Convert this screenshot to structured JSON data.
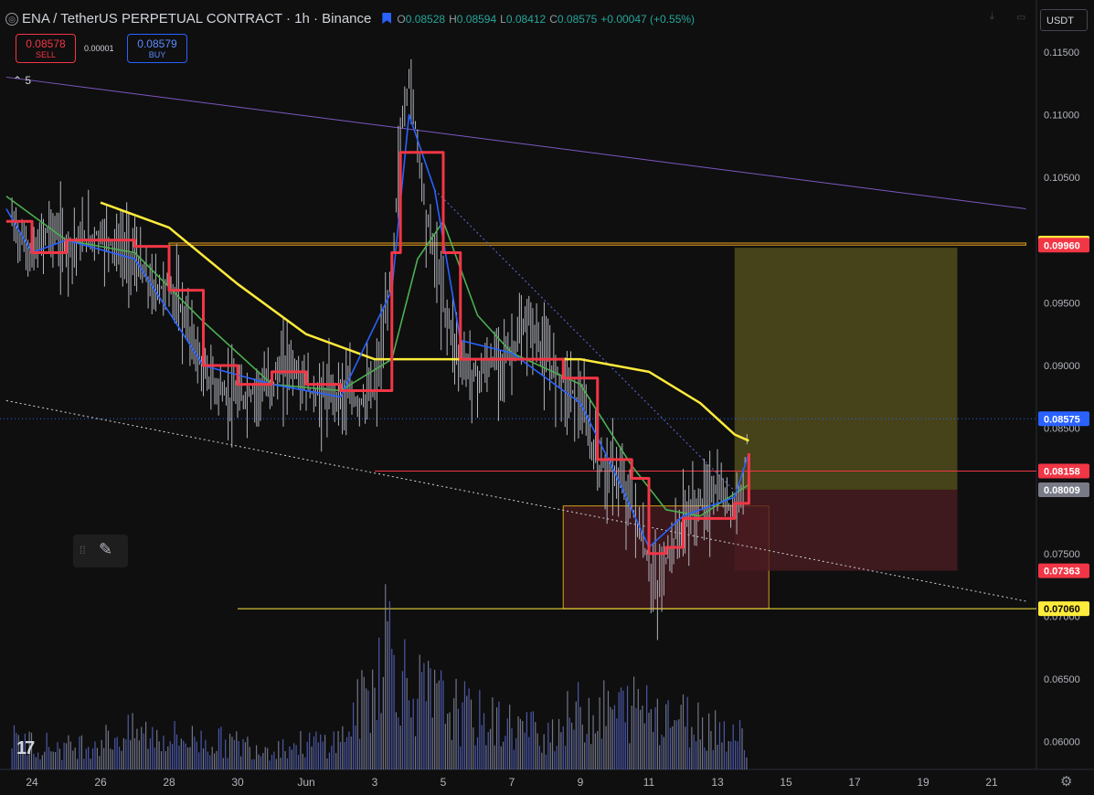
{
  "header": {
    "title": "ENA / TetherUS PERPETUAL CONTRACT · 1h · Binance",
    "ohlc": {
      "o_label": "O",
      "o": "0.08528",
      "h_label": "H",
      "h": "0.08594",
      "l_label": "L",
      "l": "0.08412",
      "c_label": "C",
      "c": "0.08575",
      "change": "+0.00047 (+0.55%)"
    }
  },
  "trade": {
    "sell_price": "0.08578",
    "sell_label": "SELL",
    "buy_price": "0.08579",
    "buy_label": "BUY",
    "spread": "0.00001"
  },
  "indicators_collapsed": "5",
  "currency": "USDT",
  "icons": {
    "symbol": "symbol-icon",
    "flag": "flag-icon",
    "drawing": "brush-icon",
    "settings": "gear-icon",
    "logo": "tradingview-logo"
  },
  "colors": {
    "background": "#0f0f0f",
    "bar": "#b2b5be",
    "ema_red": "#f23645",
    "ma_blue": "#2962ff",
    "ma_green": "#4caf50",
    "ma_yellow": "#ffeb3b",
    "trend_purple": "#7e57c2",
    "zone_fill": "#4a1b20",
    "zone_border": "#d4a017",
    "target_fill": "#6b6420",
    "stop_fill": "#4a1b20",
    "volume": "#3d4aa0"
  },
  "chart_data": {
    "type": "line",
    "symbol": "ENA/USDT",
    "timeframe": "1h",
    "ylim": [
      0.0585,
      0.1175
    ],
    "y_ticks": [
      "0.11500",
      "0.11000",
      "0.10500",
      "0.10000",
      "0.09500",
      "0.09000",
      "0.08500",
      "0.08000",
      "0.07500",
      "0.07000",
      "0.06500",
      "0.06000"
    ],
    "x_ticks": [
      "24",
      "26",
      "28",
      "30",
      "Jun",
      "3",
      "5",
      "7",
      "9",
      "11",
      "13",
      "15",
      "17",
      "19",
      "21"
    ],
    "grid": false,
    "price_path": [
      {
        "t": "May 23 10:00",
        "p": 0.1015
      },
      {
        "t": "May 24 00:00",
        "p": 0.0985
      },
      {
        "t": "May 24 12:00",
        "p": 0.101
      },
      {
        "t": "May 25 00:00",
        "p": 0.0995
      },
      {
        "t": "May 26 00:00",
        "p": 0.1005
      },
      {
        "t": "May 27 00:00",
        "p": 0.0985
      },
      {
        "t": "May 27 12:00",
        "p": 0.096
      },
      {
        "t": "May 28 00:00",
        "p": 0.0965
      },
      {
        "t": "May 28 12:00",
        "p": 0.0935
      },
      {
        "t": "May 29 00:00",
        "p": 0.0895
      },
      {
        "t": "May 29 12:00",
        "p": 0.088
      },
      {
        "t": "May 30 00:00",
        "p": 0.087
      },
      {
        "t": "May 30 12:00",
        "p": 0.088
      },
      {
        "t": "May 31 00:00",
        "p": 0.0885
      },
      {
        "t": "May 31 12:00",
        "p": 0.0905
      },
      {
        "t": "Jun 1 00:00",
        "p": 0.088
      },
      {
        "t": "Jun 1 12:00",
        "p": 0.0875
      },
      {
        "t": "Jun 2 00:00",
        "p": 0.088
      },
      {
        "t": "Jun 2 12:00",
        "p": 0.087
      },
      {
        "t": "Jun 3 00:00",
        "p": 0.088
      },
      {
        "t": "Jun 3 06:00",
        "p": 0.092
      },
      {
        "t": "Jun 3 12:00",
        "p": 0.0975
      },
      {
        "t": "Jun 3 18:00",
        "p": 0.108
      },
      {
        "t": "Jun 4 00:00",
        "p": 0.113
      },
      {
        "t": "Jun 4 06:00",
        "p": 0.108
      },
      {
        "t": "Jun 4 12:00",
        "p": 0.102
      },
      {
        "t": "Jun 4 18:00",
        "p": 0.099
      },
      {
        "t": "Jun 5 00:00",
        "p": 0.095
      },
      {
        "t": "Jun 5 12:00",
        "p": 0.0905
      },
      {
        "t": "Jun 6 00:00",
        "p": 0.089
      },
      {
        "t": "Jun 6 12:00",
        "p": 0.0905
      },
      {
        "t": "Jun 7 00:00",
        "p": 0.091
      },
      {
        "t": "Jun 7 12:00",
        "p": 0.0935
      },
      {
        "t": "Jun 8 00:00",
        "p": 0.0905
      },
      {
        "t": "Jun 8 12:00",
        "p": 0.089
      },
      {
        "t": "Jun 9 00:00",
        "p": 0.087
      },
      {
        "t": "Jun 9 12:00",
        "p": 0.082
      },
      {
        "t": "Jun 10 00:00",
        "p": 0.0815
      },
      {
        "t": "Jun 10 12:00",
        "p": 0.079
      },
      {
        "t": "Jun 11 00:00",
        "p": 0.074
      },
      {
        "t": "Jun 11 06:00",
        "p": 0.072
      },
      {
        "t": "Jun 11 12:00",
        "p": 0.0745
      },
      {
        "t": "Jun 12 00:00",
        "p": 0.0775
      },
      {
        "t": "Jun 12 12:00",
        "p": 0.079
      },
      {
        "t": "Jun 13 00:00",
        "p": 0.08
      },
      {
        "t": "Jun 13 12:00",
        "p": 0.0785
      },
      {
        "t": "Jun 13 18:00",
        "p": 0.081
      },
      {
        "t": "Jun 13 22:00",
        "p": 0.0857
      }
    ],
    "last_price": 0.08575,
    "levels": [
      {
        "label": "0.09977",
        "value": 0.09977,
        "color": "#ffeb3b",
        "text_color": "#000000"
      },
      {
        "label": "0.09960",
        "value": 0.0996,
        "color": "#f23645",
        "text_color": "#ffffff"
      },
      {
        "label": "0.08575",
        "value": 0.08575,
        "color": "#2962ff",
        "text_color": "#ffffff"
      },
      {
        "label": "0.08158",
        "value": 0.08158,
        "color": "#f23645",
        "text_color": "#ffffff"
      },
      {
        "label": "0.08009",
        "value": 0.08009,
        "color": "#787b86",
        "text_color": "#ffffff"
      },
      {
        "label": "0.07363",
        "value": 0.07363,
        "color": "#f23645",
        "text_color": "#ffffff"
      },
      {
        "label": "0.07060",
        "value": 0.0706,
        "color": "#ffeb3b",
        "text_color": "#000000"
      }
    ],
    "zones": [
      {
        "name": "supply-zone",
        "t_start": "May 28 00:00",
        "t_end": "Jun 22 00:00",
        "top": 0.09977,
        "bottom": 0.0996
      },
      {
        "name": "demand-zone",
        "t_start": "Jun 8 12:00",
        "t_end": "Jun 14 12:00",
        "top": 0.0788,
        "bottom": 0.0706
      }
    ],
    "position": {
      "t_start": "Jun 13 12:00",
      "t_end": "Jun 20 00:00",
      "target": 0.0994,
      "entry": 0.08009,
      "stop": 0.07363
    },
    "trendlines": [
      {
        "name": "resistance-trendline",
        "from": {
          "t": "May 23 06:00",
          "p": 0.113
        },
        "to": {
          "t": "Jun 22 00:00",
          "p": 0.1025
        }
      },
      {
        "name": "support-trendline",
        "from": {
          "t": "May 23 06:00",
          "p": 0.0872
        },
        "to": {
          "t": "Jun 22 00:00",
          "p": 0.0712
        }
      }
    ],
    "horizontal_lines": [
      {
        "name": "low-line",
        "value": 0.0706,
        "t_start": "May 30 00:00"
      },
      {
        "name": "mid-line",
        "value": 0.08158,
        "t_start": "Jun 3 00:00"
      }
    ],
    "moving_averages": [
      {
        "name": "ma-yellow",
        "color": "#ffeb3b",
        "points": [
          {
            "t": "May 26 00:00",
            "p": 0.103
          },
          {
            "t": "May 28 00:00",
            "p": 0.101
          },
          {
            "t": "May 30 00:00",
            "p": 0.0965
          },
          {
            "t": "Jun 1 00:00",
            "p": 0.0925
          },
          {
            "t": "Jun 3 00:00",
            "p": 0.0905
          },
          {
            "t": "Jun 5 00:00",
            "p": 0.0905
          },
          {
            "t": "Jun 7 00:00",
            "p": 0.0905
          },
          {
            "t": "Jun 9 00:00",
            "p": 0.0905
          },
          {
            "t": "Jun 11 00:00",
            "p": 0.0895
          },
          {
            "t": "Jun 12 12:00",
            "p": 0.087
          },
          {
            "t": "Jun 13 12:00",
            "p": 0.0845
          },
          {
            "t": "Jun 13 22:00",
            "p": 0.084
          }
        ]
      },
      {
        "name": "ma-green",
        "color": "#4caf50",
        "points": [
          {
            "t": "May 23 06:00",
            "p": 0.1035
          },
          {
            "t": "May 25 00:00",
            "p": 0.1
          },
          {
            "t": "May 27 00:00",
            "p": 0.099
          },
          {
            "t": "May 29 00:00",
            "p": 0.0935
          },
          {
            "t": "May 31 00:00",
            "p": 0.0885
          },
          {
            "t": "Jun 2 00:00",
            "p": 0.088
          },
          {
            "t": "Jun 3 12:00",
            "p": 0.0905
          },
          {
            "t": "Jun 4 06:00",
            "p": 0.0985
          },
          {
            "t": "Jun 5 00:00",
            "p": 0.1015
          },
          {
            "t": "Jun 6 00:00",
            "p": 0.094
          },
          {
            "t": "Jun 7 00:00",
            "p": 0.091
          },
          {
            "t": "Jun 9 00:00",
            "p": 0.0885
          },
          {
            "t": "Jun 10 12:00",
            "p": 0.082
          },
          {
            "t": "Jun 11 12:00",
            "p": 0.0785
          },
          {
            "t": "Jun 12 12:00",
            "p": 0.078
          },
          {
            "t": "Jun 13 22:00",
            "p": 0.0805
          }
        ]
      },
      {
        "name": "ma-blue",
        "color": "#2962ff",
        "points": [
          {
            "t": "May 23 06:00",
            "p": 0.1025
          },
          {
            "t": "May 24 00:00",
            "p": 0.099
          },
          {
            "t": "May 25 00:00",
            "p": 0.1
          },
          {
            "t": "May 27 00:00",
            "p": 0.0985
          },
          {
            "t": "May 29 00:00",
            "p": 0.09
          },
          {
            "t": "May 31 00:00",
            "p": 0.0885
          },
          {
            "t": "Jun 2 00:00",
            "p": 0.0875
          },
          {
            "t": "Jun 3 12:00",
            "p": 0.096
          },
          {
            "t": "Jun 4 00:00",
            "p": 0.11
          },
          {
            "t": "Jun 4 18:00",
            "p": 0.104
          },
          {
            "t": "Jun 5 12:00",
            "p": 0.092
          },
          {
            "t": "Jun 7 00:00",
            "p": 0.091
          },
          {
            "t": "Jun 9 00:00",
            "p": 0.087
          },
          {
            "t": "Jun 10 00:00",
            "p": 0.0815
          },
          {
            "t": "Jun 11 00:00",
            "p": 0.0755
          },
          {
            "t": "Jun 12 00:00",
            "p": 0.078
          },
          {
            "t": "Jun 13 12:00",
            "p": 0.0795
          },
          {
            "t": "Jun 13 22:00",
            "p": 0.083
          }
        ]
      },
      {
        "name": "ema-red-step",
        "color": "#f23645",
        "points": [
          {
            "t": "May 23 06:00",
            "p": 0.1015
          },
          {
            "t": "May 24 00:00",
            "p": 0.099
          },
          {
            "t": "May 25 00:00",
            "p": 0.1
          },
          {
            "t": "May 27 00:00",
            "p": 0.0995
          },
          {
            "t": "May 28 00:00",
            "p": 0.096
          },
          {
            "t": "May 29 00:00",
            "p": 0.09
          },
          {
            "t": "May 30 00:00",
            "p": 0.0885
          },
          {
            "t": "May 31 00:00",
            "p": 0.0895
          },
          {
            "t": "Jun 1 00:00",
            "p": 0.0885
          },
          {
            "t": "Jun 2 00:00",
            "p": 0.088
          },
          {
            "t": "Jun 3 00:00",
            "p": 0.088
          },
          {
            "t": "Jun 3 12:00",
            "p": 0.099
          },
          {
            "t": "Jun 3 18:00",
            "p": 0.107
          },
          {
            "t": "Jun 4 12:00",
            "p": 0.107
          },
          {
            "t": "Jun 5 00:00",
            "p": 0.099
          },
          {
            "t": "Jun 5 12:00",
            "p": 0.0905
          },
          {
            "t": "Jun 7 00:00",
            "p": 0.0905
          },
          {
            "t": "Jun 8 12:00",
            "p": 0.089
          },
          {
            "t": "Jun 9 12:00",
            "p": 0.0825
          },
          {
            "t": "Jun 10 12:00",
            "p": 0.081
          },
          {
            "t": "Jun 11 00:00",
            "p": 0.075
          },
          {
            "t": "Jun 11 12:00",
            "p": 0.0755
          },
          {
            "t": "Jun 12 00:00",
            "p": 0.0778
          },
          {
            "t": "Jun 13 12:00",
            "p": 0.079
          },
          {
            "t": "Jun 13 22:00",
            "p": 0.083
          }
        ]
      }
    ],
    "volume_profile": [
      {
        "t": "May 23 10:00",
        "v": 0.2
      },
      {
        "t": "May 25 00:00",
        "v": 0.15
      },
      {
        "t": "May 27 00:00",
        "v": 0.25
      },
      {
        "t": "May 29 00:00",
        "v": 0.2
      },
      {
        "t": "May 31 00:00",
        "v": 0.15
      },
      {
        "t": "Jun 2 00:00",
        "v": 0.2
      },
      {
        "t": "Jun 3 00:00",
        "v": 0.6
      },
      {
        "t": "Jun 3 06:00",
        "v": 1.0
      },
      {
        "t": "Jun 4 00:00",
        "v": 0.55
      },
      {
        "t": "Jun 5 00:00",
        "v": 0.45
      },
      {
        "t": "Jun 6 00:00",
        "v": 0.35
      },
      {
        "t": "Jun 7 00:00",
        "v": 0.3
      },
      {
        "t": "Jun 8 00:00",
        "v": 0.25
      },
      {
        "t": "Jun 9 00:00",
        "v": 0.4
      },
      {
        "t": "Jun 10 00:00",
        "v": 0.4
      },
      {
        "t": "Jun 11 00:00",
        "v": 0.45
      },
      {
        "t": "Jun 12 00:00",
        "v": 0.35
      },
      {
        "t": "Jun 13 00:00",
        "v": 0.3
      },
      {
        "t": "Jun 13 22:00",
        "v": 0.2
      }
    ]
  }
}
